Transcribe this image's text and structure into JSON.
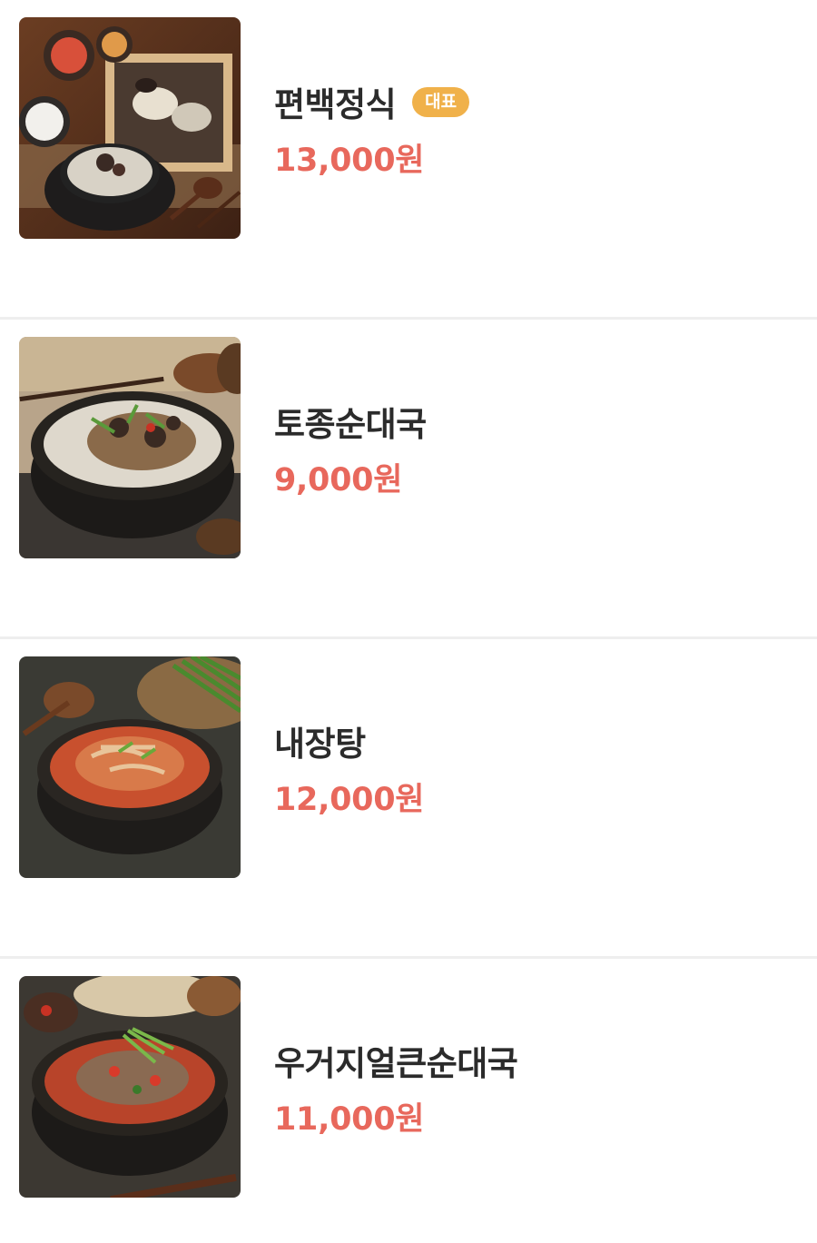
{
  "menu": {
    "items": [
      {
        "name": "편백정식",
        "badge": "대표",
        "price": "13,000원",
        "image": "pyeonbaek-set-meal-photo"
      },
      {
        "name": "토종순대국",
        "badge": null,
        "price": "9,000원",
        "image": "sundae-gukbap-photo"
      },
      {
        "name": "내장탕",
        "badge": null,
        "price": "12,000원",
        "image": "naejang-tang-photo"
      },
      {
        "name": "우거지얼큰순대국",
        "badge": null,
        "price": "11,000원",
        "image": "spicy-ugeoji-sundae-soup-photo"
      }
    ]
  },
  "colors": {
    "price": "#e8685c",
    "badge": "#f0b14a",
    "name": "#2b2b2b",
    "divider": "#eeeeee"
  }
}
